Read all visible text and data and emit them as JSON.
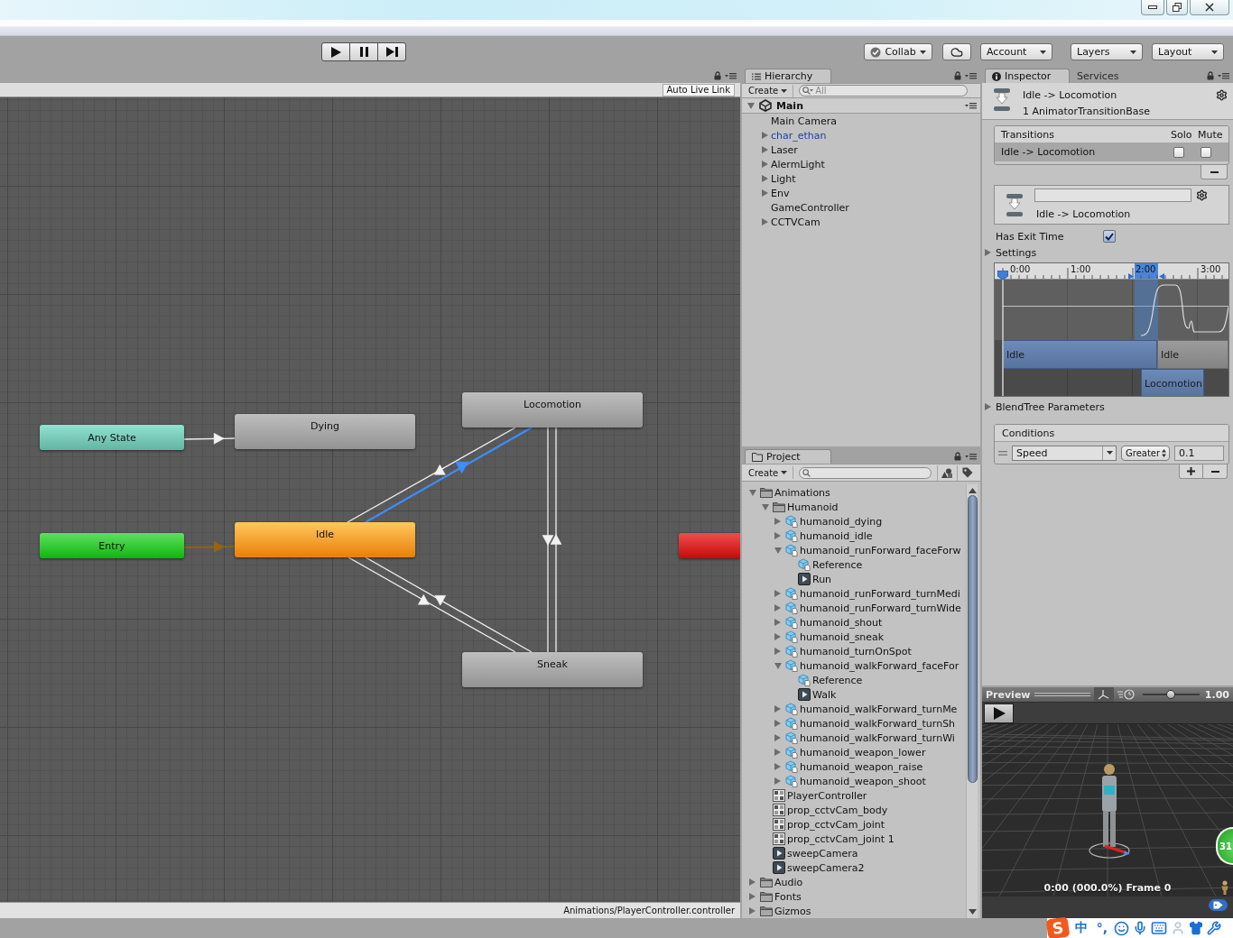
{
  "toolbar": {
    "collab": "Collab",
    "menus": [
      "Account",
      "Layers",
      "Layout"
    ]
  },
  "animator": {
    "live_link": "Auto Live Link",
    "nodes": [
      {
        "label": "Any State",
        "kind": "any"
      },
      {
        "label": "Dying",
        "kind": "state"
      },
      {
        "label": "Locomotion",
        "kind": "state"
      },
      {
        "label": "Entry",
        "kind": "entry"
      },
      {
        "label": "Idle",
        "kind": "default"
      },
      {
        "label": "Sneak",
        "kind": "state"
      },
      {
        "kind": "exit"
      }
    ],
    "transitions": [
      {
        "kind": "normal",
        "selected": false
      },
      {
        "kind": "entry",
        "selected": false
      },
      {
        "kind": "normal",
        "selected": false
      },
      {
        "kind": "normal",
        "selected": true
      },
      {
        "kind": "normal",
        "selected": false
      },
      {
        "kind": "normal",
        "selected": false
      },
      {
        "kind": "normal",
        "selected": false
      },
      {
        "kind": "normal",
        "selected": false
      }
    ],
    "path": "Animations/PlayerController.controller"
  },
  "hierarchy": {
    "tab": "Hierarchy",
    "create": "Create",
    "search": {
      "placeholder": "All"
    },
    "scene": {
      "name": "Main",
      "expanded": true
    },
    "items": [
      {
        "name": "Main Camera",
        "prefab": false
      },
      {
        "name": "char_ethan",
        "prefab": true,
        "expanded": false
      },
      {
        "name": "Laser",
        "prefab": false,
        "expanded": false
      },
      {
        "name": "AlermLight",
        "prefab": false,
        "expanded": false
      },
      {
        "name": "Light",
        "prefab": false,
        "expanded": false
      },
      {
        "name": "Env",
        "prefab": false,
        "expanded": false
      },
      {
        "name": "GameController",
        "prefab": false
      },
      {
        "name": "CCTVCam",
        "prefab": false,
        "expanded": false
      }
    ]
  },
  "project": {
    "tab": "Project",
    "create": "Create",
    "tree": [
      {
        "name": "Animations",
        "kind": "folder",
        "expanded": true,
        "children": [
          {
            "name": "Humanoid",
            "kind": "folder",
            "expanded": true,
            "children": [
              {
                "name": "humanoid_dying",
                "kind": "model",
                "expanded": false
              },
              {
                "name": "humanoid_idle",
                "kind": "model",
                "expanded": false
              },
              {
                "name": "humanoid_runForward_faceForw",
                "kind": "model",
                "expanded": true,
                "children": [
                  {
                    "name": "Reference",
                    "kind": "model"
                  },
                  {
                    "name": "Run",
                    "kind": "clip"
                  }
                ]
              },
              {
                "name": "humanoid_runForward_turnMedi",
                "kind": "model",
                "expanded": false
              },
              {
                "name": "humanoid_runForward_turnWide",
                "kind": "model",
                "expanded": false
              },
              {
                "name": "humanoid_shout",
                "kind": "model",
                "expanded": false
              },
              {
                "name": "humanoid_sneak",
                "kind": "model",
                "expanded": false
              },
              {
                "name": "humanoid_turnOnSpot",
                "kind": "model",
                "expanded": false
              },
              {
                "name": "humanoid_walkForward_faceFor",
                "kind": "model",
                "expanded": true,
                "children": [
                  {
                    "name": "Reference",
                    "kind": "model"
                  },
                  {
                    "name": "Walk",
                    "kind": "clip"
                  }
                ]
              },
              {
                "name": "humanoid_walkForward_turnMe",
                "kind": "model",
                "expanded": false
              },
              {
                "name": "humanoid_walkForward_turnSh",
                "kind": "model",
                "expanded": false
              },
              {
                "name": "humanoid_walkForward_turnWi",
                "kind": "model",
                "expanded": false
              },
              {
                "name": "humanoid_weapon_lower",
                "kind": "model",
                "expanded": false
              },
              {
                "name": "humanoid_weapon_raise",
                "kind": "model",
                "expanded": false
              },
              {
                "name": "humanoid_weapon_shoot",
                "kind": "model",
                "expanded": false
              }
            ]
          },
          {
            "name": "PlayerController",
            "kind": "controller"
          },
          {
            "name": "prop_cctvCam_body",
            "kind": "controller"
          },
          {
            "name": "prop_cctvCam_joint",
            "kind": "controller"
          },
          {
            "name": "prop_cctvCam_joint 1",
            "kind": "controller"
          },
          {
            "name": "sweepCamera",
            "kind": "clip"
          },
          {
            "name": "sweepCamera2",
            "kind": "clip"
          }
        ]
      },
      {
        "name": "Audio",
        "kind": "folder",
        "expanded": false
      },
      {
        "name": "Fonts",
        "kind": "folder",
        "expanded": false
      },
      {
        "name": "Gizmos",
        "kind": "folder",
        "expanded": false
      }
    ]
  },
  "inspector": {
    "tabs": [
      {
        "label": "Inspector",
        "selected": true
      },
      {
        "label": "Services",
        "selected": false
      }
    ],
    "title": "Idle -> Locomotion",
    "subtitle": "1 AnimatorTransitionBase",
    "transitions": {
      "header": "Transitions",
      "solo": "Solo",
      "mute": "Mute",
      "rows": [
        {
          "name": "Idle -> Locomotion",
          "selected": true,
          "solo": false,
          "mute": false
        }
      ]
    },
    "transition_label": "Idle -> Locomotion",
    "has_exit_time": {
      "label": "Has Exit Time",
      "checked": true
    },
    "settings": {
      "label": "Settings",
      "expanded": false
    },
    "timeline": {
      "ticks": [
        "0:00",
        "1:00",
        "2:00",
        "3:00"
      ],
      "clips": [
        {
          "label": "Idle",
          "kind": "source"
        },
        {
          "label": "Idle",
          "kind": "source-after"
        },
        {
          "label": "Locomotion",
          "kind": "destination"
        }
      ]
    },
    "blend_tree": {
      "label": "BlendTree Parameters",
      "expanded": false
    },
    "conditions": {
      "header": "Conditions",
      "rows": [
        {
          "parameter": "Speed",
          "mode": "Greater",
          "value": "0.1"
        }
      ]
    }
  },
  "preview": {
    "title": "Preview",
    "speed": {
      "level": 0.5,
      "reading": "1.00"
    },
    "status": "0:00 (000.0%) Frame 0"
  },
  "floating_ball": {
    "text": "31"
  },
  "ime_bar": {
    "logo": "S",
    "language": "中",
    "punctuation": "°,"
  }
}
